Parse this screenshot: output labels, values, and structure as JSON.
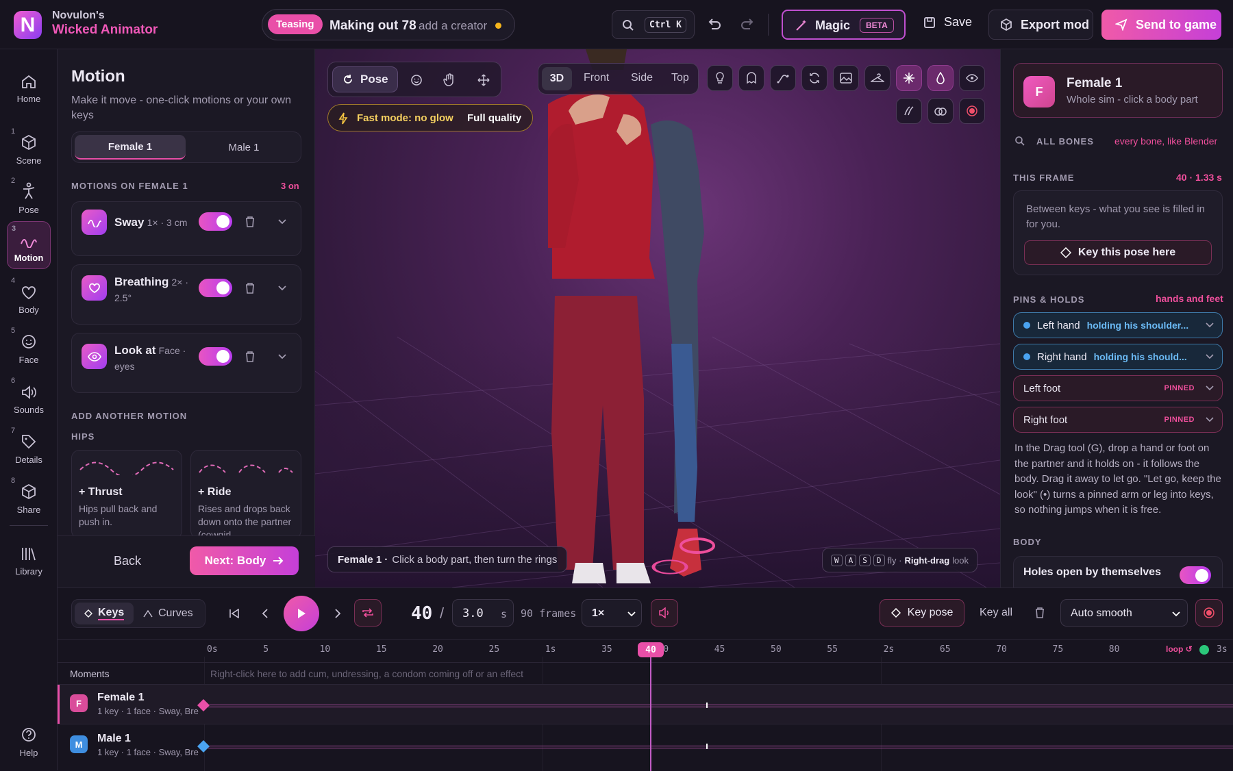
{
  "app": {
    "brand_line1": "Novulon's",
    "brand_line2": "Wicked Animator",
    "logo_letter": "N"
  },
  "topbar": {
    "mood_tag": "Teasing",
    "project_name": "Making out 78",
    "add_creator": "add a creator",
    "search_shortcut": "Ctrl K",
    "magic_label": "Magic",
    "magic_badge": "BETA",
    "save_label": "Save",
    "export_label": "Export mod",
    "send_label": "Send to game"
  },
  "rail": {
    "items": [
      {
        "num": "",
        "label": "Home"
      },
      {
        "num": "1",
        "label": "Scene"
      },
      {
        "num": "2",
        "label": "Pose"
      },
      {
        "num": "3",
        "label": "Motion"
      },
      {
        "num": "4",
        "label": "Body"
      },
      {
        "num": "5",
        "label": "Face"
      },
      {
        "num": "6",
        "label": "Sounds"
      },
      {
        "num": "7",
        "label": "Details"
      },
      {
        "num": "8",
        "label": "Share"
      },
      {
        "num": "",
        "label": "Library"
      },
      {
        "num": "",
        "label": "Help"
      }
    ]
  },
  "motion": {
    "title": "Motion",
    "subtitle": "Make it move - one-click motions or your own keys",
    "tabs": [
      "Female 1",
      "Male 1"
    ],
    "section_label": "MOTIONS ON FEMALE 1",
    "count": "3 on",
    "items": [
      {
        "name": "Sway",
        "meta": "1× · 3 cm",
        "meta2": ""
      },
      {
        "name": "Breathing",
        "meta": "2× ·",
        "meta2": "2.5°"
      },
      {
        "name": "Look at",
        "meta": "Face ·",
        "meta2": "eyes"
      }
    ],
    "add_label": "ADD ANOTHER MOTION",
    "group_label": "HIPS",
    "presets": [
      {
        "name": "+ Thrust",
        "desc": "Hips pull back and push in."
      },
      {
        "name": "+ Ride",
        "desc": "Rises and drops back down onto the partner (cowgirl,"
      }
    ],
    "back_label": "Back",
    "next_label": "Next: Body"
  },
  "viewport": {
    "tool_pose": "Pose",
    "views": [
      "3D",
      "Front",
      "Side",
      "Top"
    ],
    "fast_mode": "Fast mode: no glow",
    "full_quality": "Full quality",
    "hint_name": "Female 1 ·",
    "hint_text": "Click a body part, then turn the rings",
    "keys": [
      "W",
      "A",
      "S",
      "D"
    ],
    "fly": "fly ·",
    "rdrag": "Right-drag",
    "look": "look"
  },
  "right": {
    "avatar_letter": "F",
    "sim_name": "Female 1",
    "sim_sub": "Whole sim - click a body part",
    "all_bones": "ALL BONES",
    "all_bones_hint": "every bone, like Blender",
    "this_frame": "THIS FRAME",
    "frame_info": "40 · 1.33 s",
    "frame_text": "Between keys - what you see is filled in for you.",
    "key_pose_here": "Key this pose here",
    "pins_label": "PINS & HOLDS",
    "pins_hint": "hands and feet",
    "holds": [
      {
        "label": "Left hand",
        "detail": "holding his shoulder...",
        "type": "blue"
      },
      {
        "label": "Right hand",
        "detail": "holding his should...",
        "type": "blue"
      },
      {
        "label": "Left foot",
        "detail": "PINNED",
        "type": "pink"
      },
      {
        "label": "Right foot",
        "detail": "PINNED",
        "type": "pink"
      }
    ],
    "help_text": "In the Drag tool (G), drop a hand or foot on the partner and it holds on - it follows the body. Drag it away to let go. \"Let go, keep the look\" (•) turns a pinned arm or leg into keys, so nothing jumps when it is free.",
    "body_label": "BODY",
    "holes_label": "Holes open by themselves"
  },
  "timeline": {
    "keys_tab": "Keys",
    "curves_tab": "Curves",
    "frame": "40",
    "duration": "3.0",
    "unit": "s",
    "frames": "90 frames",
    "speed": "1×",
    "key_pose": "Key pose",
    "key_all": "Key all",
    "smooth": "Auto smooth",
    "ticks": [
      "0s",
      "5",
      "10",
      "15",
      "20",
      "25",
      "1s",
      "35",
      "40",
      "45",
      "50",
      "55",
      "2s",
      "65",
      "70",
      "75",
      "80"
    ],
    "loop_label": "loop",
    "end_tick": "3s",
    "moments_label": "Moments",
    "moments_hint": "Right-click here to add cum, undressing, a condom coming off or an effect",
    "tracks": [
      {
        "letter": "F",
        "name": "Female 1",
        "meta": "1 key · 1 face · Sway, Bre"
      },
      {
        "letter": "M",
        "name": "Male 1",
        "meta": "1 key · 1 face · Sway, Bre"
      }
    ]
  },
  "colors": {
    "accent": "#e94fa8",
    "purple": "#b83cf0",
    "blue": "#4aa3f0",
    "bg": "#16131f"
  }
}
